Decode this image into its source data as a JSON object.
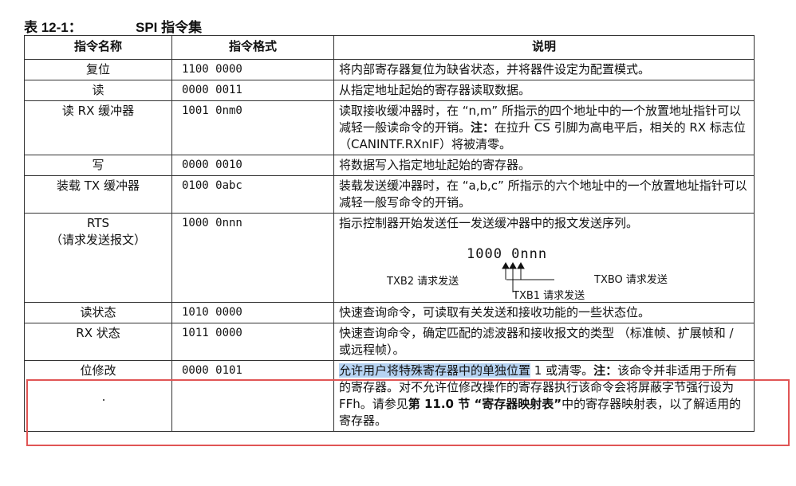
{
  "caption": {
    "number": "表 12-1：",
    "title": "SPI 指令集"
  },
  "headers": {
    "name": "指令名称",
    "format": "指令格式",
    "desc": "说明"
  },
  "rows": [
    {
      "name": "复位",
      "format": "1100 0000",
      "desc": "将内部寄存器复位为缺省状态，并将器件设定为配置模式。"
    },
    {
      "name": "读",
      "format": "0000 0011",
      "desc": "从指定地址起始的寄存器读取数据。"
    },
    {
      "name": "读 RX 缓冲器",
      "format": "1001 0nm0",
      "desc_a": "读取接收缓冲器时，在 “n,m” 所指示的四个地址中的一个放置地址指针可以减轻一般读命令的开销。",
      "note": "注：",
      "desc_b": "在拉升 ",
      "cs": "CS",
      "desc_c": " 引脚为高电平后，相关的 RX 标志位 （CANINTF.RXnIF）将被清零。"
    },
    {
      "name": "写",
      "format": "0000 0010",
      "desc": "将数据写入指定地址起始的寄存器。"
    },
    {
      "name": "装载 TX 缓冲器",
      "format": "0100 0abc",
      "desc": "装载发送缓冲器时，在 “a,b,c” 所指示的六个地址中的一个放置地址指针可以减轻一般写命令的开销。"
    },
    {
      "name": "RTS",
      "name2": "（请求发送报文）",
      "format": "1000 0nnn",
      "desc": "指示控制器开始发送任一发送缓冲器中的报文发送序列。",
      "diagram": {
        "code": "1000 0nnn",
        "txb2": "TXB2 请求发送",
        "txb1": "TXB1 请求发送",
        "txb0": "TXBO 请求发送"
      }
    },
    {
      "name": "读状态",
      "format": "1010 0000",
      "desc": "快速查询命令，可读取有关发送和接收功能的一些状态位。"
    },
    {
      "name": "RX 状态",
      "format": "1011 0000",
      "desc": "快速查询命令，确定匹配的滤波器和接收报文的类型 （标准帧、扩展帧和 / 或远程帧）。"
    },
    {
      "name": "位修改",
      "format": "0000 0101",
      "desc_sel": "允许用户将特殊寄存器中的单独位置",
      "desc_a": " 1 或清零。",
      "note": "注：",
      "desc_b": "该命令并非适用于所有的寄存器。对不允许位修改操作的寄存器执行该命令会将屏蔽字节强行设为 FFh。请参见",
      "ref": "第 11.0 节 “寄存器映射表”",
      "desc_c": "中的寄存器映射表，以了解适用的寄存器。"
    }
  ]
}
